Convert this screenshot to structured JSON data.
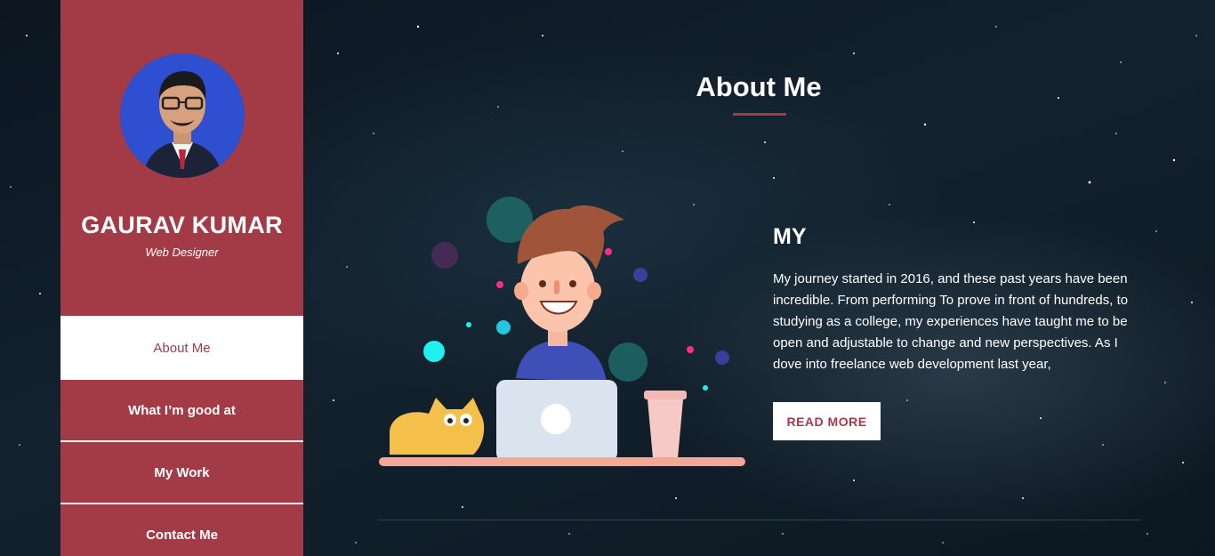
{
  "profile": {
    "name": "GAURAV KUMAR",
    "role": "Web Designer"
  },
  "nav": {
    "items": [
      {
        "label": "About Me",
        "active": true
      },
      {
        "label": "What I’m good at",
        "active": false
      },
      {
        "label": "My Work",
        "active": false
      },
      {
        "label": "Contact Me",
        "active": false
      }
    ]
  },
  "main": {
    "title": "About Me",
    "heading": "MY",
    "paragraph": "My journey started in 2016, and these past years have been incredible. From performing To prove in front of hundreds, to studying as a college, my experiences have taught me to be open and adjustable to change and new perspectives. As I dove into freelance web development last year,",
    "read_more_label": "READ MORE"
  },
  "colors": {
    "accent": "#a33b46",
    "background": "#0d1a24",
    "text": "#ffffff"
  },
  "icons": {
    "avatar": "profile-photo",
    "illustration": "developer-with-laptop-and-cat-illustration"
  }
}
